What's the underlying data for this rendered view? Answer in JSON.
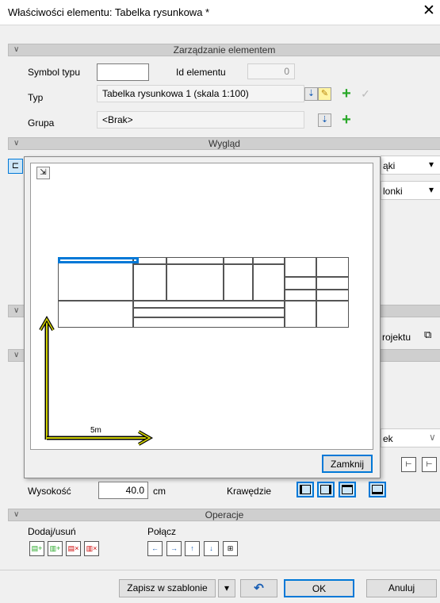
{
  "window": {
    "title": "Właściwości elementu: Tabelka rysunkowa *",
    "close": "✕"
  },
  "sections": {
    "management": "Zarządzanie elementem",
    "appearance": "Wygląd",
    "operations": "Operacje"
  },
  "management": {
    "symbol_label": "Symbol typu",
    "symbol_value": "",
    "id_label": "Id elementu",
    "id_value": "0",
    "type_label": "Typ",
    "type_value": "Tabelka rysunkowa 1 (skala 1:100)",
    "group_label": "Grupa",
    "group_value": "<Brak>"
  },
  "background_right": {
    "dd1": "ąki",
    "dd2": "lonki",
    "project": "rojektu",
    "dd3": "ek"
  },
  "preview": {
    "scale_label": "5m",
    "close_button": "Zamknij"
  },
  "bottom": {
    "height_label": "Wysokość",
    "height_value": "40.0",
    "height_unit": "cm",
    "edges_label": "Krawędzie"
  },
  "operations": {
    "add_remove_label": "Dodaj/usuń",
    "merge_label": "Połącz"
  },
  "footer": {
    "save_template": "Zapisz w szablonie",
    "ok": "OK",
    "cancel": "Anuluj"
  },
  "colors": {
    "accent": "#0078d7",
    "scale_arrow": "#d4d400"
  }
}
